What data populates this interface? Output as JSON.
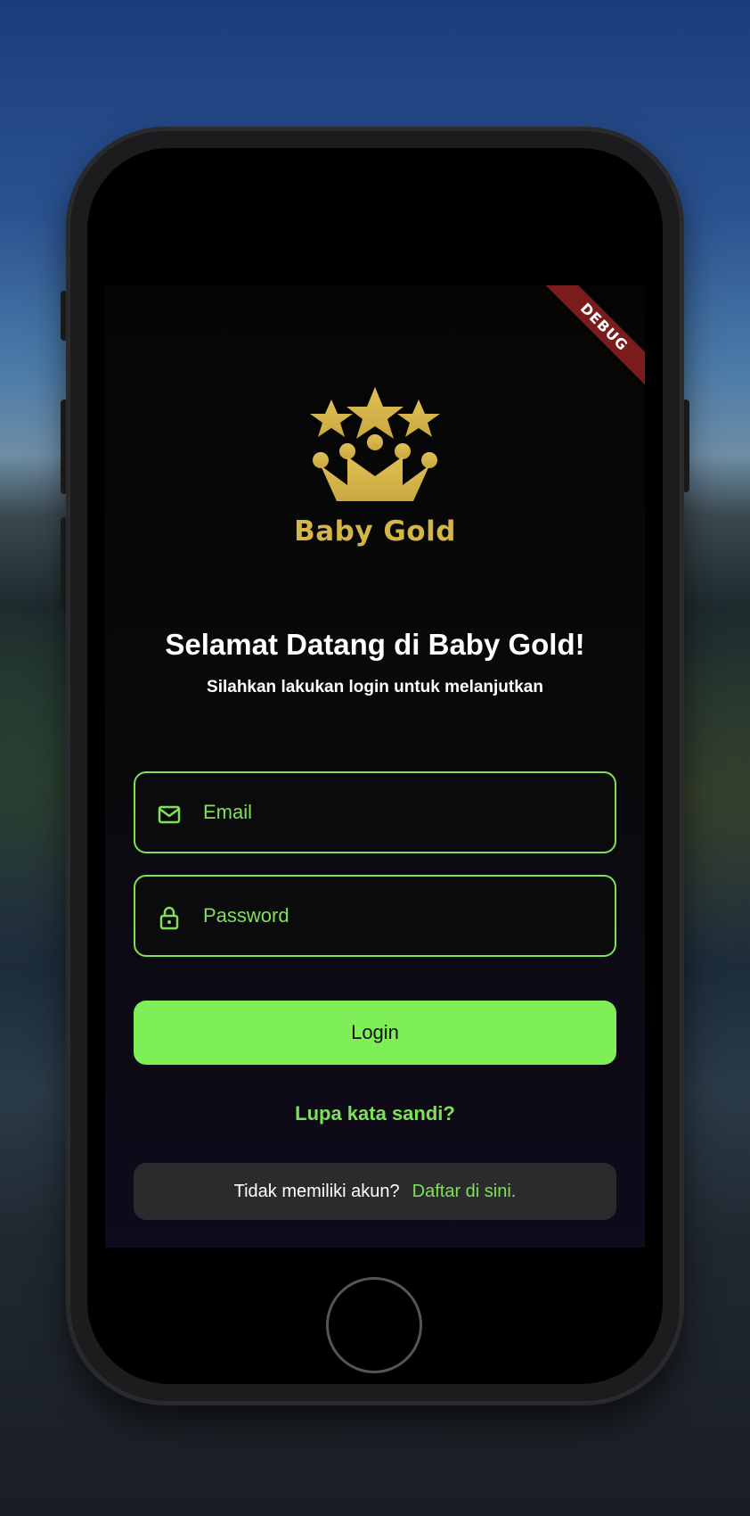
{
  "debug_banner": "DEBUG",
  "brand": {
    "logo_icon": "crown-with-stars-icon",
    "name": "Baby Gold",
    "color": "#d4b548"
  },
  "welcome": {
    "title": "Selamat Datang di Baby Gold!",
    "subtitle": "Silahkan lakukan login untuk melanjutkan"
  },
  "form": {
    "email": {
      "placeholder": "Email",
      "value": "",
      "icon": "mail-icon"
    },
    "password": {
      "placeholder": "Password",
      "value": "",
      "icon": "lock-icon"
    },
    "login_label": "Login",
    "forgot_label": "Lupa kata sandi?"
  },
  "signup": {
    "question": "Tidak memiliki akun?",
    "link_label": "Daftar di sini."
  },
  "colors": {
    "accent": "#7ee257",
    "button": "#7eef57",
    "debug": "#7a1c1c"
  }
}
